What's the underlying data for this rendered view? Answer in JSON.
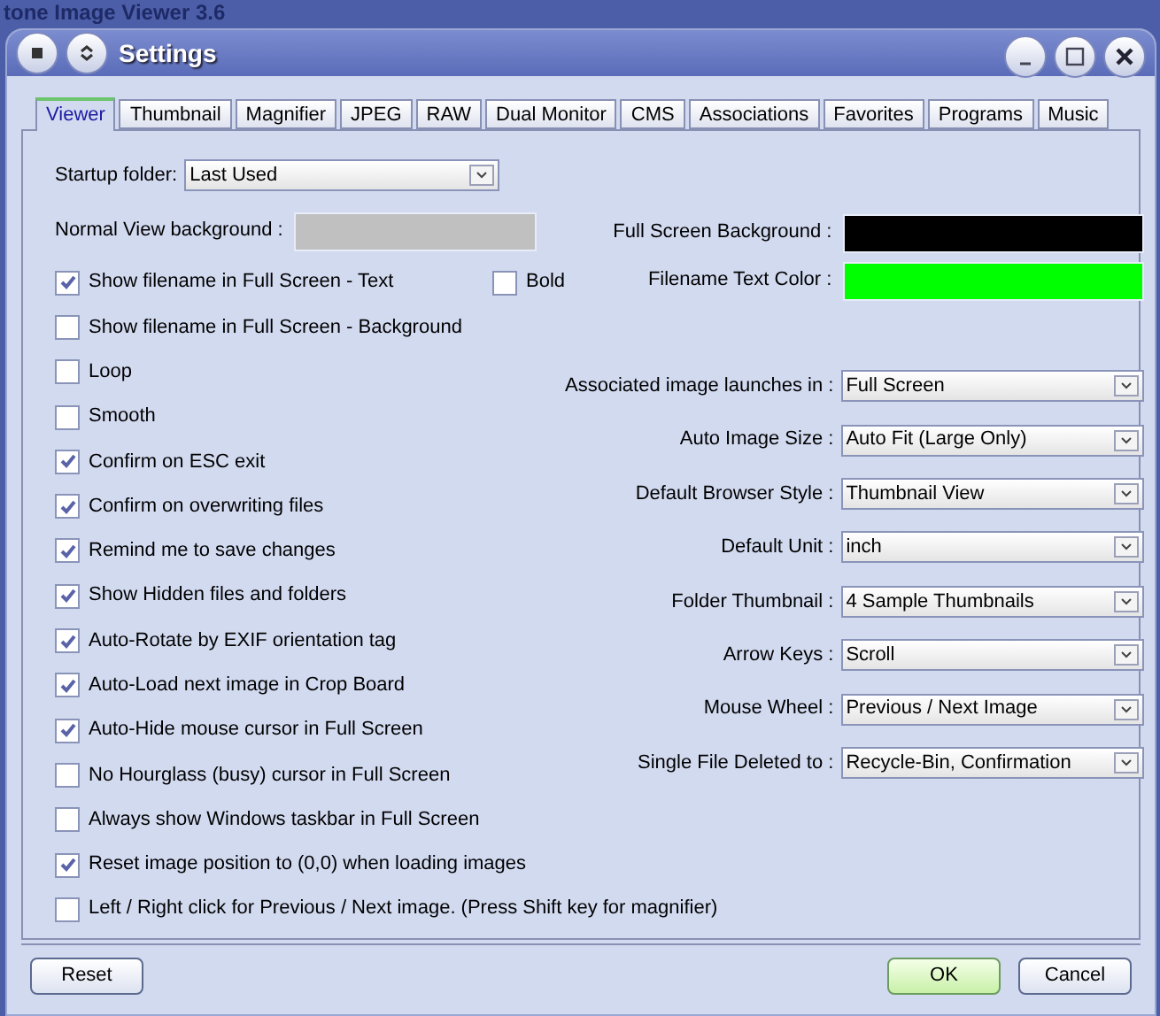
{
  "background_window": {
    "title": "tone Image Viewer 3.6"
  },
  "window": {
    "title": "Settings"
  },
  "tabs": [
    {
      "label": "Viewer",
      "selected": true
    },
    {
      "label": "Thumbnail",
      "selected": false
    },
    {
      "label": "Magnifier",
      "selected": false
    },
    {
      "label": "JPEG",
      "selected": false
    },
    {
      "label": "RAW",
      "selected": false
    },
    {
      "label": "Dual Monitor",
      "selected": false
    },
    {
      "label": "CMS",
      "selected": false
    },
    {
      "label": "Associations",
      "selected": false
    },
    {
      "label": "Favorites",
      "selected": false
    },
    {
      "label": "Programs",
      "selected": false
    },
    {
      "label": "Music",
      "selected": false
    }
  ],
  "startup_folder": {
    "label": "Startup folder:",
    "value": "Last Used"
  },
  "normal_view_background": {
    "label": "Normal View background :",
    "color": "#c0c0c0"
  },
  "color_fields": [
    {
      "label": "Full Screen Background :",
      "color": "#000000"
    },
    {
      "label": "Filename Text Color :",
      "color": "#00ff00"
    }
  ],
  "options": [
    {
      "label": "Show filename in Full Screen - Text",
      "checked": true,
      "extra": {
        "label": "Bold",
        "checked": false
      }
    },
    {
      "label": "Show filename in Full Screen - Background",
      "checked": false
    },
    {
      "label": "Loop",
      "checked": false
    },
    {
      "label": "Smooth",
      "checked": false
    },
    {
      "label": "Confirm on ESC exit",
      "checked": true
    },
    {
      "label": "Confirm on overwriting files",
      "checked": true
    },
    {
      "label": "Remind me to save changes",
      "checked": true
    },
    {
      "label": "Show Hidden files and folders",
      "checked": true
    },
    {
      "label": "Auto-Rotate by EXIF orientation tag",
      "checked": true
    },
    {
      "label": "Auto-Load next image in Crop Board",
      "checked": true
    },
    {
      "label": "Auto-Hide mouse cursor in Full Screen",
      "checked": true
    },
    {
      "label": "No Hourglass (busy) cursor in Full Screen",
      "checked": false
    },
    {
      "label": "Always show Windows taskbar in Full Screen",
      "checked": false
    },
    {
      "label": "Reset image position to (0,0) when loading images",
      "checked": true
    },
    {
      "label": "Left / Right click for Previous / Next image. (Press Shift key for magnifier)",
      "checked": false
    }
  ],
  "dropdowns": [
    {
      "label": "Associated image launches in :",
      "value": "Full Screen"
    },
    {
      "label": "Auto Image Size :",
      "value": "Auto Fit (Large Only)"
    },
    {
      "label": "Default Browser Style :",
      "value": "Thumbnail View"
    },
    {
      "label": "Default Unit :",
      "value": "inch"
    },
    {
      "label": "Folder Thumbnail :",
      "value": "4 Sample Thumbnails"
    },
    {
      "label": "Arrow Keys :",
      "value": "Scroll"
    },
    {
      "label": "Mouse Wheel :",
      "value": "Previous / Next Image"
    },
    {
      "label": "Single File Deleted to :",
      "value": "Recycle-Bin, Confirmation"
    }
  ],
  "buttons": [
    {
      "label": "Reset",
      "default": false
    },
    {
      "label": "OK",
      "default": true
    },
    {
      "label": "Cancel",
      "default": false
    }
  ]
}
